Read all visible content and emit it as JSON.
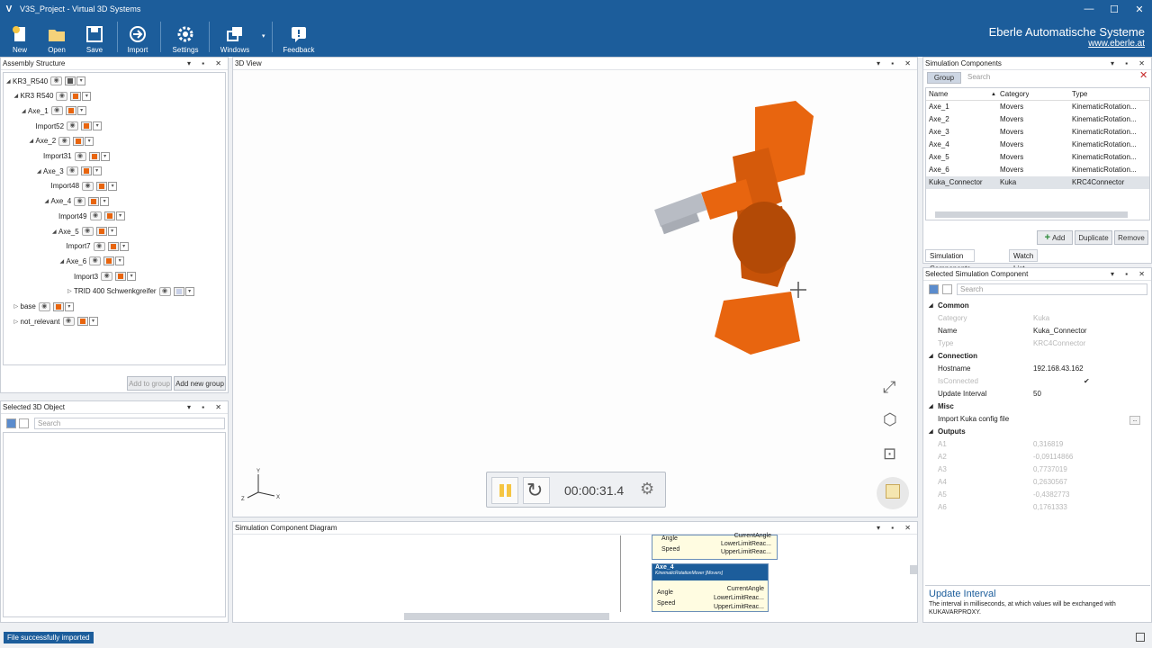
{
  "window": {
    "title": "V3S_Project - Virtual 3D Systems",
    "minimize": "—",
    "maximize": "☐",
    "close": "✕"
  },
  "ribbon": {
    "buttons": [
      {
        "label": "New"
      },
      {
        "label": "Open"
      },
      {
        "label": "Save"
      },
      {
        "label": "Import"
      },
      {
        "label": "Settings"
      },
      {
        "label": "Windows"
      },
      {
        "label": "Feedback"
      }
    ],
    "brand_name": "Eberle Automatische Systeme",
    "brand_url": "www.eberle.at"
  },
  "assembly": {
    "title": "Assembly Structure",
    "nodes": [
      {
        "label": "KR3_R540",
        "level": 0,
        "expanded": true,
        "swatch": "#555555"
      },
      {
        "label": "KR3 R540",
        "level": 1,
        "expanded": true,
        "swatch": "#e8650f"
      },
      {
        "label": "Axe_1",
        "level": 2,
        "expanded": true,
        "swatch": "#e8650f"
      },
      {
        "label": "Import52",
        "level": 3,
        "expanded": false,
        "swatch": "#e8650f"
      },
      {
        "label": "Axe_2",
        "level": 3,
        "expanded": true,
        "swatch": "#e8650f"
      },
      {
        "label": "Import31",
        "level": 4,
        "expanded": false,
        "swatch": "#e8650f"
      },
      {
        "label": "Axe_3",
        "level": 4,
        "expanded": true,
        "swatch": "#e8650f"
      },
      {
        "label": "Import48",
        "level": 5,
        "expanded": false,
        "swatch": "#e8650f"
      },
      {
        "label": "Axe_4",
        "level": 5,
        "expanded": true,
        "swatch": "#e8650f"
      },
      {
        "label": "Import49",
        "level": 6,
        "expanded": false,
        "swatch": "#e8650f"
      },
      {
        "label": "Axe_5",
        "level": 6,
        "expanded": true,
        "swatch": "#e8650f"
      },
      {
        "label": "Import7",
        "level": 7,
        "expanded": false,
        "swatch": "#e8650f"
      },
      {
        "label": "Axe_6",
        "level": 7,
        "expanded": true,
        "swatch": "#e8650f"
      },
      {
        "label": "Import3",
        "level": 8,
        "expanded": false,
        "swatch": "#e8650f"
      },
      {
        "label": "TRID 400 Schwenkgreifer",
        "level": 8,
        "expanded": false,
        "collapsed_arrow": true,
        "swatch": "#c8d0e8"
      },
      {
        "label": "base",
        "level": 1,
        "expanded": false,
        "collapsed_arrow": true,
        "swatch": "#e8650f"
      },
      {
        "label": "not_relevant",
        "level": 1,
        "expanded": false,
        "collapsed_arrow": true,
        "swatch": "#e8650f"
      }
    ],
    "add_to_group": "Add to group",
    "add_new_group": "Add new group"
  },
  "selected3d": {
    "title": "Selected 3D Object",
    "search_placeholder": "Search"
  },
  "view3d": {
    "title": "3D View",
    "time": "00:00:31.4"
  },
  "diagram": {
    "title": "Simulation Component Diagram",
    "node_top": {
      "in1": "Angle",
      "in2": "Speed",
      "out1": "CurrentAngle",
      "out2": "LowerLimitReac...",
      "out3": "UpperLimitReac..."
    },
    "node_axe4": {
      "name": "Axe_4",
      "sub": "KinematicRotationMover [Movers]",
      "in1": "Angle",
      "in2": "Speed",
      "out1": "CurrentAngle",
      "out2": "LowerLimitReac...",
      "out3": "UpperLimitReac..."
    }
  },
  "simcomp": {
    "title": "Simulation Components",
    "group": "Group",
    "search_placeholder": "Search",
    "columns": [
      "Name",
      "Category",
      "Type"
    ],
    "rows": [
      [
        "Axe_1",
        "Movers",
        "KinematicRotation..."
      ],
      [
        "Axe_2",
        "Movers",
        "KinematicRotation..."
      ],
      [
        "Axe_3",
        "Movers",
        "KinematicRotation..."
      ],
      [
        "Axe_4",
        "Movers",
        "KinematicRotation..."
      ],
      [
        "Axe_5",
        "Movers",
        "KinematicRotation..."
      ],
      [
        "Axe_6",
        "Movers",
        "KinematicRotation..."
      ],
      [
        "Kuka_Connector",
        "Kuka",
        "KRC4Connector"
      ]
    ],
    "add": "Add",
    "duplicate": "Duplicate",
    "remove": "Remove",
    "tabs": [
      "Simulation Components",
      "Watch List"
    ]
  },
  "selcomp": {
    "title": "Selected Simulation Component",
    "search_placeholder": "Search",
    "props": [
      {
        "type": "section",
        "k": "Common"
      },
      {
        "type": "dim",
        "k": "Category",
        "v": "Kuka"
      },
      {
        "type": "prop",
        "k": "Name",
        "v": "Kuka_Connector"
      },
      {
        "type": "dim",
        "k": "Type",
        "v": "KRC4Connector"
      },
      {
        "type": "section",
        "k": "Connection"
      },
      {
        "type": "prop",
        "k": "Hostname",
        "v": "192.168.43.162"
      },
      {
        "type": "dim",
        "k": "IsConnected",
        "v": "✔"
      },
      {
        "type": "prop",
        "k": "Update Interval",
        "v": "50"
      },
      {
        "type": "section",
        "k": "Misc"
      },
      {
        "type": "prop",
        "k": "Import Kuka config file",
        "v": ""
      },
      {
        "type": "section",
        "k": "Outputs"
      },
      {
        "type": "dim",
        "k": "A1",
        "v": "0,316819"
      },
      {
        "type": "dim",
        "k": "A2",
        "v": "-0,09114866"
      },
      {
        "type": "dim",
        "k": "A3",
        "v": "0,7737019"
      },
      {
        "type": "dim",
        "k": "A4",
        "v": "0,2630567"
      },
      {
        "type": "dim",
        "k": "A5",
        "v": "-0,4382773"
      },
      {
        "type": "dim",
        "k": "A6",
        "v": "0,1761333"
      }
    ],
    "desc_title": "Update Interval",
    "desc_text": "The interval in milliseconds, at which values will be exchanged with KUKAVARPROXY."
  },
  "status": {
    "message": "File successfully imported"
  },
  "colors": {
    "accent": "#1c5d9b",
    "robot": "#e8650f"
  }
}
